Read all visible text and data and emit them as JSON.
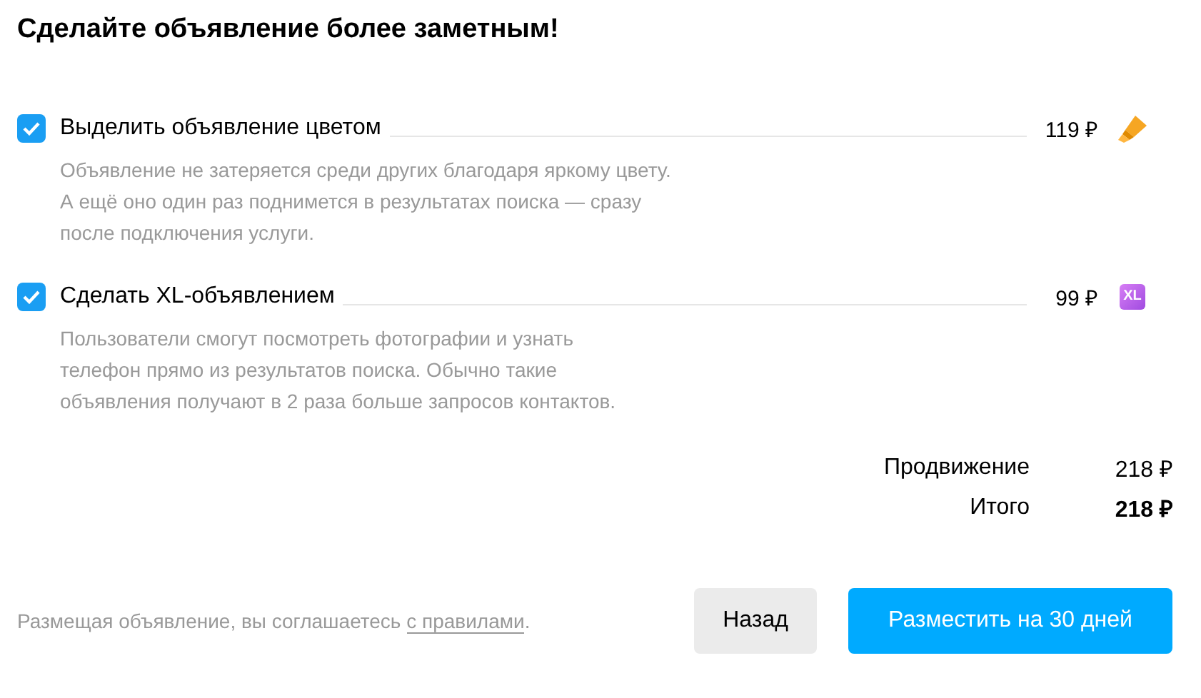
{
  "title": "Сделайте объявление более заметным!",
  "options": [
    {
      "kind": "highlight",
      "label": "Выделить объявление цветом",
      "checked": true,
      "price": "119 ₽",
      "description": "Объявление не затеряется среди других благодаря яркому цвету.\nА ещё оно один раз поднимется в результатах поиска — сразу\nпосле подключения услуги."
    },
    {
      "kind": "xl",
      "label": "Сделать XL-объявлением",
      "checked": true,
      "price": "99 ₽",
      "badge": "XL",
      "description": "Пользователи смогут посмотреть фотографии и узнать\nтелефон прямо из результатов поиска. Обычно такие\nобъявления получают в 2 раза больше запросов контактов."
    }
  ],
  "summary": [
    {
      "label": "Продвижение",
      "value": "218 ₽",
      "kind": "subtotal"
    },
    {
      "label": "Итого",
      "value": "218 ₽",
      "kind": "total"
    }
  ],
  "footer": {
    "agreement": "Размещая объявление, вы соглашаетесь ",
    "link": "с правилами",
    "after": ".",
    "back_button": "Назад",
    "submit_button": "Разместить на 30 дней"
  }
}
